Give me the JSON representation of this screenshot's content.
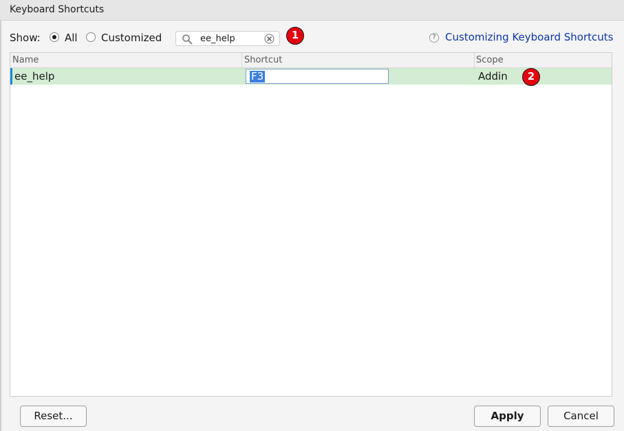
{
  "window": {
    "title": "Keyboard Shortcuts"
  },
  "toolbar": {
    "show_label": "Show:",
    "filter_options": [
      {
        "label": "All",
        "checked": true
      },
      {
        "label": "Customized",
        "checked": false
      }
    ],
    "search": {
      "value": "ee_help",
      "icon": "search-icon",
      "clear_icon": "clear-icon"
    },
    "help_link": "Customizing Keyboard Shortcuts",
    "help_icon": "help-icon"
  },
  "annotations": {
    "badge_1": "1",
    "badge_2": "2"
  },
  "table": {
    "columns": [
      "Name",
      "Shortcut",
      "Scope"
    ],
    "rows": [
      {
        "name": "ee_help",
        "shortcut": "F3",
        "scope": "Addin",
        "selected": true,
        "editing": true
      }
    ]
  },
  "buttons": {
    "reset": "Reset...",
    "apply": "Apply",
    "cancel": "Cancel"
  },
  "colors": {
    "selected_row": "#d3ecd3",
    "row_marker": "#1e88d6",
    "link": "#0b36a5",
    "badge": "#e4000f",
    "text_selection": "#3d7fe0"
  }
}
